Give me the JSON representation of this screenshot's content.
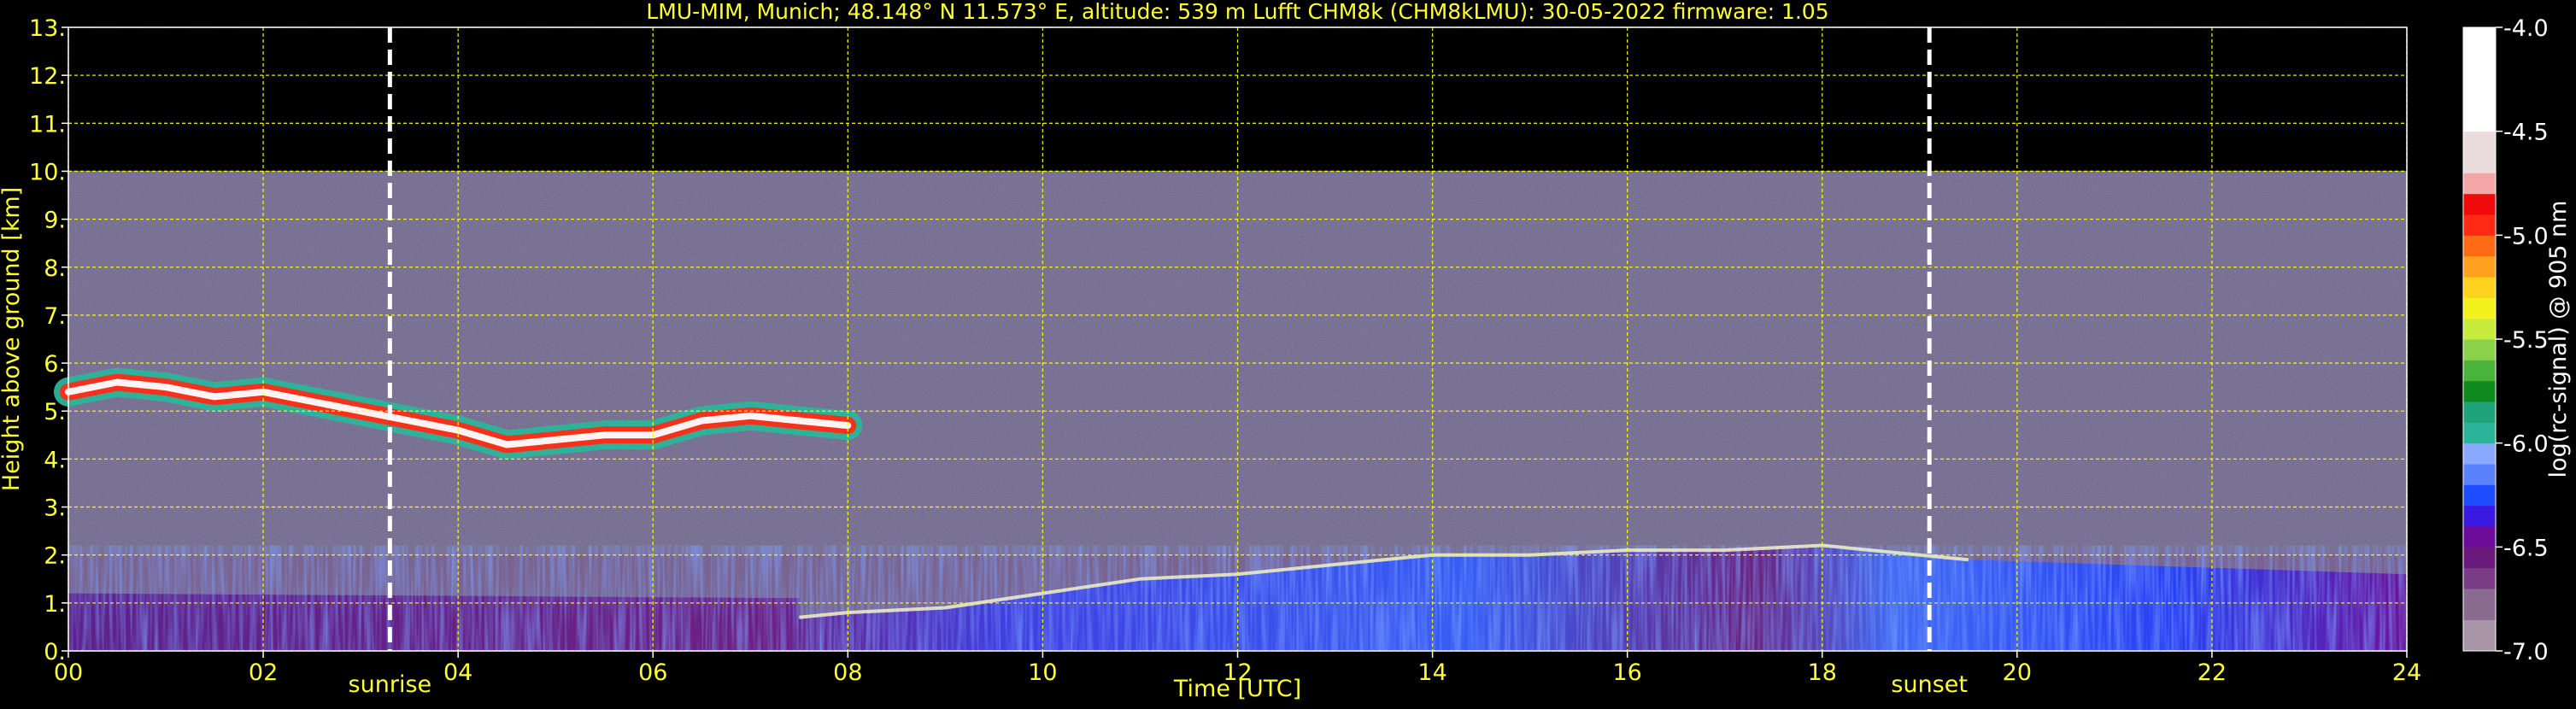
{
  "chart_data": {
    "type": "heatmap",
    "title": "LMU-MIM, Munich; 48.148° N 11.573° E, altitude: 539 m    Lufft CHM8k (CHM8kLMU): 30-05-2022    firmware: 1.05",
    "xlabel": "Time [UTC]",
    "ylabel": "Height above ground [km]",
    "xlim": [
      0,
      24
    ],
    "ylim": [
      0,
      13
    ],
    "x_ticks": [
      0,
      2,
      4,
      6,
      8,
      10,
      12,
      14,
      16,
      18,
      20,
      22,
      24
    ],
    "x_tick_labels": [
      "00",
      "02",
      "04",
      "06",
      "08",
      "10",
      "12",
      "14",
      "16",
      "18",
      "20",
      "22",
      "24"
    ],
    "y_ticks": [
      0,
      1,
      2,
      3,
      4,
      5,
      6,
      7,
      8,
      9,
      10,
      11,
      12,
      13
    ],
    "y_tick_labels": [
      "0.",
      "1.",
      "2.",
      "3.",
      "4.",
      "5.",
      "6.",
      "7.",
      "8.",
      "9.",
      "10.",
      "11.",
      "12.",
      "13."
    ],
    "grid": true,
    "data_top_km": 10,
    "markers": [
      {
        "label": "sunrise",
        "x": 3.3
      },
      {
        "label": "sunset",
        "x": 19.1
      }
    ],
    "colorbar": {
      "label": "log(rc-signal) @ 905 nm",
      "range": [
        -7.0,
        -4.0
      ],
      "ticks": [
        -4.0,
        -4.5,
        -5.0,
        -5.5,
        -6.0,
        -6.5,
        -7.0
      ],
      "tick_labels": [
        "-4.0",
        "-4.5",
        "-5.0",
        "-5.5",
        "-6.0",
        "-6.5",
        "-7.0"
      ],
      "levels": [
        {
          "from": -7.0,
          "to": -6.85,
          "color": "#a896a8"
        },
        {
          "from": -6.85,
          "to": -6.7,
          "color": "#8a6a8e"
        },
        {
          "from": -6.7,
          "to": -6.6,
          "color": "#7a3c84"
        },
        {
          "from": -6.6,
          "to": -6.5,
          "color": "#6a1a7a"
        },
        {
          "from": -6.5,
          "to": -6.4,
          "color": "#6c0a9a"
        },
        {
          "from": -6.4,
          "to": -6.3,
          "color": "#3a1ae0"
        },
        {
          "from": -6.3,
          "to": -6.2,
          "color": "#1e4cff"
        },
        {
          "from": -6.2,
          "to": -6.1,
          "color": "#5a82ff"
        },
        {
          "from": -6.1,
          "to": -6.0,
          "color": "#8aa8ff"
        },
        {
          "from": -6.0,
          "to": -5.9,
          "color": "#2bb49a"
        },
        {
          "from": -5.9,
          "to": -5.8,
          "color": "#1ea37a"
        },
        {
          "from": -5.8,
          "to": -5.7,
          "color": "#0f8a1e"
        },
        {
          "from": -5.7,
          "to": -5.6,
          "color": "#4ab43a"
        },
        {
          "from": -5.6,
          "to": -5.5,
          "color": "#8ad24a"
        },
        {
          "from": -5.5,
          "to": -5.4,
          "color": "#c8ec3c"
        },
        {
          "from": -5.4,
          "to": -5.3,
          "color": "#f2f21e"
        },
        {
          "from": -5.3,
          "to": -5.2,
          "color": "#ffd21e"
        },
        {
          "from": -5.2,
          "to": -5.1,
          "color": "#ffa01e"
        },
        {
          "from": -5.1,
          "to": -5.0,
          "color": "#ff6a14"
        },
        {
          "from": -5.0,
          "to": -4.9,
          "color": "#ff2a14"
        },
        {
          "from": -4.9,
          "to": -4.8,
          "color": "#f00a0a"
        },
        {
          "from": -4.8,
          "to": -4.7,
          "color": "#f4a6a6"
        },
        {
          "from": -4.7,
          "to": -4.5,
          "color": "#eadcdc"
        },
        {
          "from": -4.5,
          "to": -4.0,
          "color": "#ffffff"
        }
      ]
    },
    "features": [
      {
        "name": "mid-level cloud layer",
        "x": [
          0.0,
          0.5,
          1.0,
          1.5,
          2.0,
          2.5,
          3.0,
          3.5,
          4.0,
          4.5,
          5.0,
          5.5,
          6.0,
          6.5,
          7.0,
          7.5,
          8.0
        ],
        "y": [
          5.4,
          5.6,
          5.5,
          5.3,
          5.4,
          5.2,
          5.0,
          4.8,
          4.6,
          4.3,
          4.4,
          4.5,
          4.5,
          4.8,
          4.9,
          4.8,
          4.7
        ]
      },
      {
        "name": "boundary layer top",
        "x": [
          7.5,
          8.0,
          9.0,
          10.0,
          11.0,
          12.0,
          13.0,
          14.0,
          15.0,
          16.0,
          17.0,
          18.0,
          19.0,
          19.5
        ],
        "y": [
          0.7,
          0.8,
          0.9,
          1.2,
          1.5,
          1.6,
          1.8,
          2.0,
          2.0,
          2.1,
          2.1,
          2.2,
          2.0,
          1.9
        ]
      }
    ]
  }
}
